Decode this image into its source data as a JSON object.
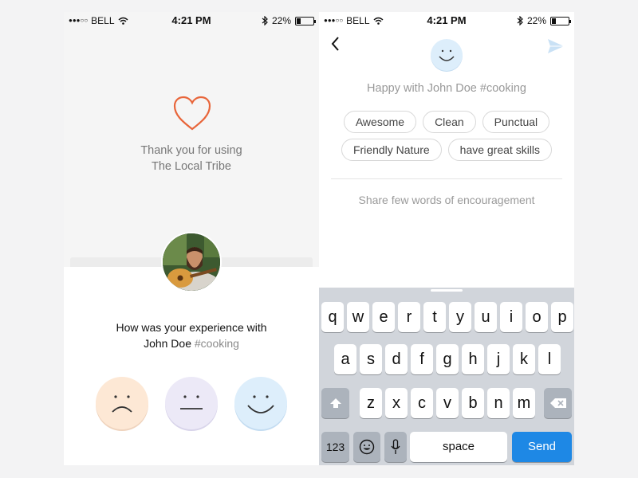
{
  "left_screen": {
    "status": {
      "carrier": "BELL",
      "time": "4:21 PM",
      "battery": "22%"
    },
    "thanks_line1": "Thank you for using",
    "thanks_line2": "The Local Tribe",
    "question_line1": "How was your experience with",
    "question_name": "John Doe",
    "question_tag": "#cooking",
    "ratings": [
      "sad-face",
      "neutral-face",
      "happy-face"
    ]
  },
  "right_screen": {
    "status": {
      "carrier": "BELL",
      "time": "4:21 PM",
      "battery": "22%"
    },
    "header_text": "Happy with John Doe #cooking",
    "tags_row1": [
      "Awesome",
      "Clean",
      "Punctual"
    ],
    "tags_row2": [
      "Friendly Nature",
      "have great skills"
    ],
    "comment_placeholder": "Share few words of encouragement",
    "keyboard": {
      "row1": [
        "q",
        "w",
        "e",
        "r",
        "t",
        "y",
        "u",
        "i",
        "o",
        "p"
      ],
      "row2": [
        "a",
        "s",
        "d",
        "f",
        "g",
        "h",
        "j",
        "k",
        "l"
      ],
      "row3": [
        "z",
        "x",
        "c",
        "v",
        "b",
        "n",
        "m"
      ],
      "numbers_key": "123",
      "space_key": "space",
      "send_key": "Send"
    }
  },
  "colors": {
    "heart": "#e8653a",
    "send_key": "#1e88e5",
    "send_icon": "#c9e1f5"
  }
}
